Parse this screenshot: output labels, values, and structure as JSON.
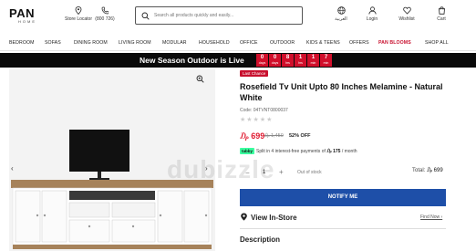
{
  "header": {
    "logo_main": "PAN",
    "logo_sub": "HOME",
    "store_locator": "Store Locator",
    "phone": "(800 726)",
    "search_placeholder": "Search all products quickly and easily...",
    "lang": "العربية",
    "login": "Login",
    "wishlist": "Wishlist",
    "cart": "Cart"
  },
  "nav": {
    "items": [
      "BEDROOM",
      "SOFAS",
      "DINING ROOM",
      "LIVING ROOM",
      "MODULAR",
      "HOUSEHOLD",
      "OFFICE",
      "OUTDOOR",
      "KIDS & TEENS",
      "OFFERS",
      "PAN BLOOMS",
      "SHOP ALL"
    ],
    "highlight_color": "#c8102e"
  },
  "banner": {
    "text": "New Season Outdoor is Live",
    "countdown": [
      {
        "num": "0",
        "label": "days"
      },
      {
        "num": "0",
        "label": "days"
      },
      {
        "num": "8",
        "label": "hrs"
      },
      {
        "num": "1",
        "label": "hrs"
      },
      {
        "num": "1",
        "label": "min"
      },
      {
        "num": "7",
        "label": "min"
      }
    ]
  },
  "gallery": {
    "prev_arrow": "‹",
    "next_arrow": "›",
    "watermark": "dubizzle"
  },
  "product": {
    "badge": "Last Chance",
    "title": "Rosefield Tv Unit Upto 80 Inches Melamine - Natural White",
    "code": "Code: 04TVNT0800037",
    "stars": "★★★★★",
    "price_now": "₯ 699",
    "price_old": "₯ 1,450",
    "discount": "52% OFF",
    "tabby_logo": "tabby",
    "tabby_text_pre": "Split in 4 interest-free payments of",
    "tabby_amount": "₯ 175",
    "tabby_text_post": "/ month",
    "qty_minus": "−",
    "qty": "1",
    "qty_plus": "+",
    "stock": "Out of stock",
    "total_label": "Total:",
    "total_value": "₯ 699",
    "notify": "NOTIFY ME",
    "instore": "View In-Store",
    "findnow": "Find Now ›",
    "description": "Description"
  },
  "colors": {
    "accent_red": "#e0192f",
    "notify_blue": "#1e4fa8",
    "banner_bg": "#0a0a0a",
    "tabby_green": "#3bffa0"
  }
}
